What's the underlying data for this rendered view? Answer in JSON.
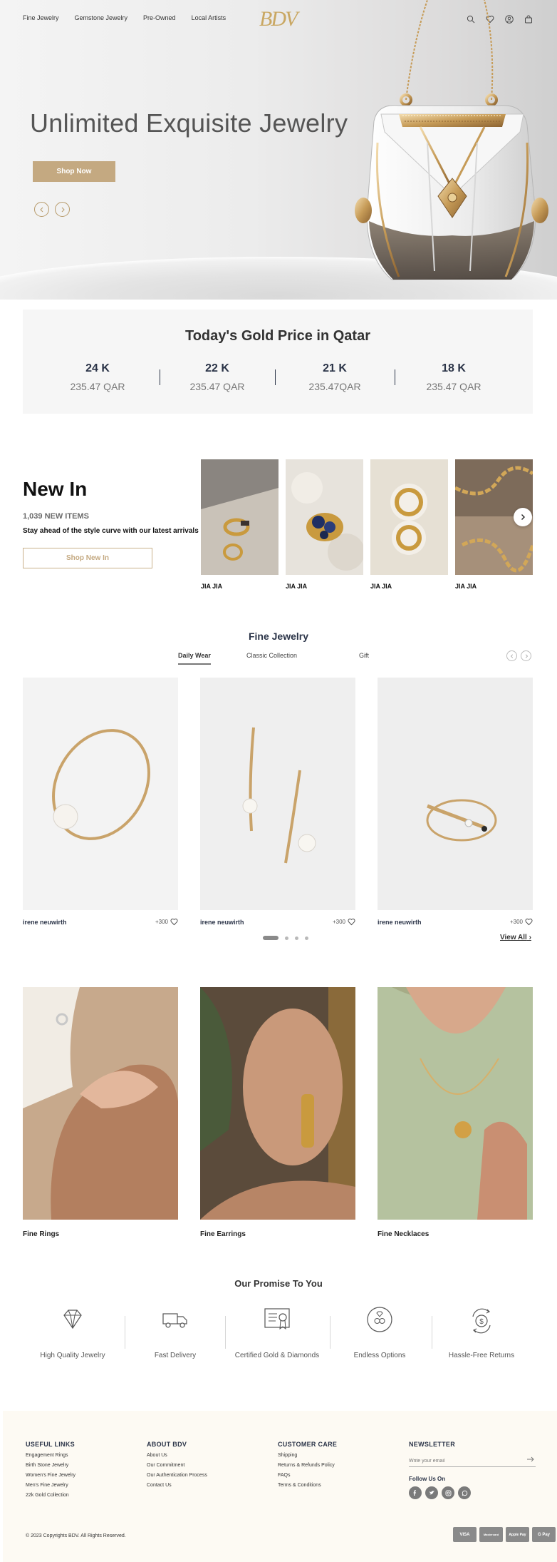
{
  "header": {
    "nav": [
      "Fine Jewelry",
      "Gemstone Jewelry",
      "Pre-Owned",
      "Local Artists"
    ],
    "logo": "BDV",
    "icons": [
      "search-icon",
      "heart-icon",
      "user-icon",
      "bag-icon"
    ]
  },
  "hero": {
    "title": "Unlimited Exquisite Jewelry",
    "cta": "Shop Now"
  },
  "gold_price": {
    "title": "Today's Gold Price in Qatar",
    "items": [
      {
        "karat": "24 K",
        "price": "235.47 QAR"
      },
      {
        "karat": "22 K",
        "price": "235.47 QAR"
      },
      {
        "karat": "21 K",
        "price": "235.47QAR"
      },
      {
        "karat": "18 K",
        "price": "235.47 QAR"
      }
    ]
  },
  "new_in": {
    "title": "New In",
    "count": "1,039 NEW ITEMS",
    "subtitle": "Stay ahead of the style curve with our latest arrivals",
    "cta": "Shop New In",
    "products": [
      {
        "brand": "JIA JIA"
      },
      {
        "brand": "JIA JIA"
      },
      {
        "brand": "JIA JIA"
      },
      {
        "brand": "JIA JIA"
      }
    ]
  },
  "fine_jewelry": {
    "title": "Fine Jewelry",
    "tabs": [
      "Daily Wear",
      "Classic Collection",
      "Gift"
    ],
    "active_tab": "Daily Wear",
    "products": [
      {
        "brand": "irene neuwirth",
        "likes": "+300"
      },
      {
        "brand": "irene neuwirth",
        "likes": "+300"
      },
      {
        "brand": "irene neuwirth",
        "likes": "+300"
      }
    ],
    "view_all": "View All"
  },
  "categories": [
    {
      "label": "Fine Rings"
    },
    {
      "label": "Fine Earrings"
    },
    {
      "label": "Fine Necklaces"
    }
  ],
  "promise": {
    "title": "Our Promise To You",
    "items": [
      {
        "label": "High Quality Jewelry",
        "icon": "diamond-icon"
      },
      {
        "label": "Fast Delivery",
        "icon": "truck-icon"
      },
      {
        "label": "Certified Gold & Diamonds",
        "icon": "certificate-icon"
      },
      {
        "label": "Endless Options",
        "icon": "infinity-icon"
      },
      {
        "label": "Hassle-Free Returns",
        "icon": "returns-icon"
      }
    ]
  },
  "footer": {
    "useful_links": {
      "title": "USEFUL LINKS",
      "links": [
        "Engagement Rings",
        "Birth Stone Jewelry",
        "Women's Fine Jewelry",
        "Men's Fine Jewelry",
        "22k Gold Collection"
      ]
    },
    "about": {
      "title": "ABOUT BDV",
      "links": [
        "About Us",
        "Our Commitment",
        "Our Authentication Process",
        "Contact Us"
      ]
    },
    "care": {
      "title": "CUSTOMER CARE",
      "links": [
        "Shipping",
        "Returns & Refunds Policy",
        "FAQs",
        "Terms & Conditions"
      ]
    },
    "newsletter": {
      "title": "NEWSLETTER",
      "placeholder": "Write your email",
      "follow": "Follow Us On",
      "socials": [
        "facebook-icon",
        "twitter-icon",
        "instagram-icon",
        "whatsapp-icon"
      ]
    },
    "copyright": "© 2023 Copyrights BDV. All Rights Reserved.",
    "payments": [
      "VISA",
      "Mastercard",
      "Apple Pay",
      "G Pay"
    ]
  },
  "colors": {
    "gold_accent": "#c4a981",
    "navy": "#2b3448",
    "footer_bg": "#fdfaf3"
  }
}
